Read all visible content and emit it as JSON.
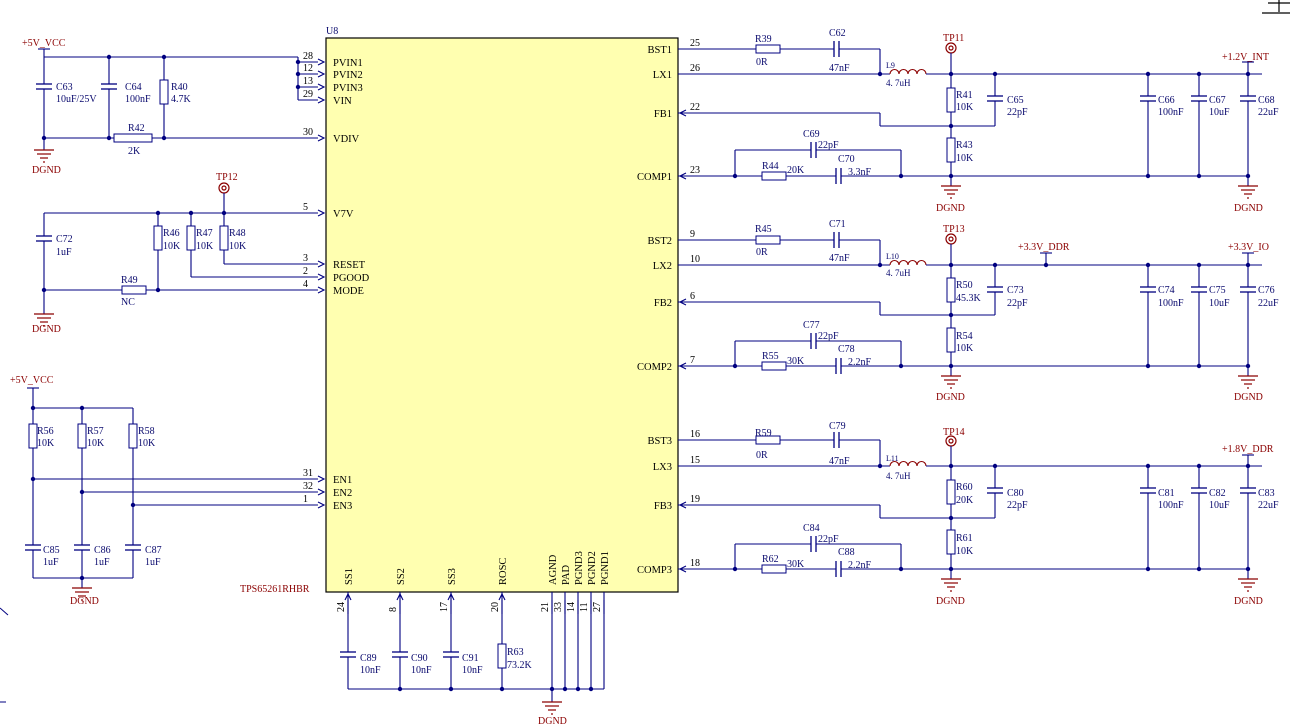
{
  "chip": {
    "ref": "U8",
    "part": "TPS65261RHBR",
    "left_pins": [
      {
        "num": "28",
        "name": "PVIN1"
      },
      {
        "num": "12",
        "name": "PVIN2"
      },
      {
        "num": "13",
        "name": "PVIN3"
      },
      {
        "num": "29",
        "name": "VIN"
      },
      {
        "num": "30",
        "name": "VDIV"
      },
      {
        "num": "5",
        "name": "V7V"
      },
      {
        "num": "3",
        "name": "RESET"
      },
      {
        "num": "2",
        "name": "PGOOD"
      },
      {
        "num": "4",
        "name": "MODE"
      },
      {
        "num": "31",
        "name": "EN1"
      },
      {
        "num": "32",
        "name": "EN2"
      },
      {
        "num": "1",
        "name": "EN3"
      }
    ],
    "right_pins": [
      {
        "num": "25",
        "name": "BST1"
      },
      {
        "num": "26",
        "name": "LX1"
      },
      {
        "num": "22",
        "name": "FB1"
      },
      {
        "num": "23",
        "name": "COMP1"
      },
      {
        "num": "9",
        "name": "BST2"
      },
      {
        "num": "10",
        "name": "LX2"
      },
      {
        "num": "6",
        "name": "FB2"
      },
      {
        "num": "7",
        "name": "COMP2"
      },
      {
        "num": "16",
        "name": "BST3"
      },
      {
        "num": "15",
        "name": "LX3"
      },
      {
        "num": "19",
        "name": "FB3"
      },
      {
        "num": "18",
        "name": "COMP3"
      }
    ],
    "bottom_pins": [
      {
        "num": "24",
        "name": "SS1"
      },
      {
        "num": "8",
        "name": "SS2"
      },
      {
        "num": "17",
        "name": "SS3"
      },
      {
        "num": "20",
        "name": "ROSC"
      },
      {
        "num": "21",
        "name": "AGND"
      },
      {
        "num": "33",
        "name": "PAD"
      },
      {
        "num": "14",
        "name": "PGND3"
      },
      {
        "num": "11",
        "name": "PGND2"
      },
      {
        "num": "27",
        "name": "PGND1"
      }
    ]
  },
  "nets": {
    "vcc_top": "+5V_VCC",
    "vcc_en": "+5V_VCC",
    "out1": "+1.2V_INT",
    "out2_ddr": "+3.3V_DDR",
    "out2_io": "+3.3V_IO",
    "out3": "+1.8V_DDR",
    "gnd": "DGND"
  },
  "test_points": [
    "TP11",
    "TP12",
    "TP13",
    "TP14"
  ],
  "components": {
    "C63": {
      "ref": "C63",
      "val": "10uF/25V"
    },
    "C64": {
      "ref": "C64",
      "val": "100nF"
    },
    "R40": {
      "ref": "R40",
      "val": "4.7K"
    },
    "R42": {
      "ref": "R42",
      "val": "2K"
    },
    "C72": {
      "ref": "C72",
      "val": "1uF"
    },
    "R46": {
      "ref": "R46",
      "val": "10K"
    },
    "R47": {
      "ref": "R47",
      "val": "10K"
    },
    "R48": {
      "ref": "R48",
      "val": "10K"
    },
    "R49": {
      "ref": "R49",
      "val": "NC"
    },
    "R56": {
      "ref": "R56",
      "val": "10K"
    },
    "R57": {
      "ref": "R57",
      "val": "10K"
    },
    "R58": {
      "ref": "R58",
      "val": "10K"
    },
    "C85": {
      "ref": "C85",
      "val": "1uF"
    },
    "C86": {
      "ref": "C86",
      "val": "1uF"
    },
    "C87": {
      "ref": "C87",
      "val": "1uF"
    },
    "R39": {
      "ref": "R39",
      "val": "0R"
    },
    "C62": {
      "ref": "C62",
      "val": "47nF"
    },
    "L9": {
      "ref": "L9",
      "val": "4. 7uH"
    },
    "R41": {
      "ref": "R41",
      "val": "10K"
    },
    "C65": {
      "ref": "C65",
      "val": "22pF"
    },
    "R43": {
      "ref": "R43",
      "val": "10K"
    },
    "C69": {
      "ref": "C69",
      "val": "22pF"
    },
    "R44": {
      "ref": "R44",
      "val": "20K"
    },
    "C70": {
      "ref": "C70",
      "val": "3.3nF"
    },
    "C66": {
      "ref": "C66",
      "val": "100nF"
    },
    "C67": {
      "ref": "C67",
      "val": "10uF"
    },
    "C68": {
      "ref": "C68",
      "val": "22uF"
    },
    "R45": {
      "ref": "R45",
      "val": "0R"
    },
    "C71": {
      "ref": "C71",
      "val": "47nF"
    },
    "L10": {
      "ref": "L10",
      "val": "4. 7uH"
    },
    "R50": {
      "ref": "R50",
      "val": "45.3K"
    },
    "C73": {
      "ref": "C73",
      "val": "22pF"
    },
    "R54": {
      "ref": "R54",
      "val": "10K"
    },
    "C77": {
      "ref": "C77",
      "val": "22pF"
    },
    "R55": {
      "ref": "R55",
      "val": "30K"
    },
    "C78": {
      "ref": "C78",
      "val": "2.2nF"
    },
    "C74": {
      "ref": "C74",
      "val": "100nF"
    },
    "C75": {
      "ref": "C75",
      "val": "10uF"
    },
    "C76": {
      "ref": "C76",
      "val": "22uF"
    },
    "R59": {
      "ref": "R59",
      "val": "0R"
    },
    "C79": {
      "ref": "C79",
      "val": "47nF"
    },
    "L11": {
      "ref": "L11",
      "val": "4. 7uH"
    },
    "R60": {
      "ref": "R60",
      "val": "20K"
    },
    "C80": {
      "ref": "C80",
      "val": "22pF"
    },
    "R61": {
      "ref": "R61",
      "val": "10K"
    },
    "C84": {
      "ref": "C84",
      "val": "22pF"
    },
    "R62": {
      "ref": "R62",
      "val": "30K"
    },
    "C88": {
      "ref": "C88",
      "val": "2.2nF"
    },
    "C81": {
      "ref": "C81",
      "val": "100nF"
    },
    "C82": {
      "ref": "C82",
      "val": "10uF"
    },
    "C83": {
      "ref": "C83",
      "val": "22uF"
    },
    "C89": {
      "ref": "C89",
      "val": "10nF"
    },
    "C90": {
      "ref": "C90",
      "val": "10nF"
    },
    "C91": {
      "ref": "C91",
      "val": "10nF"
    },
    "R63": {
      "ref": "R63",
      "val": "73.2K"
    }
  }
}
